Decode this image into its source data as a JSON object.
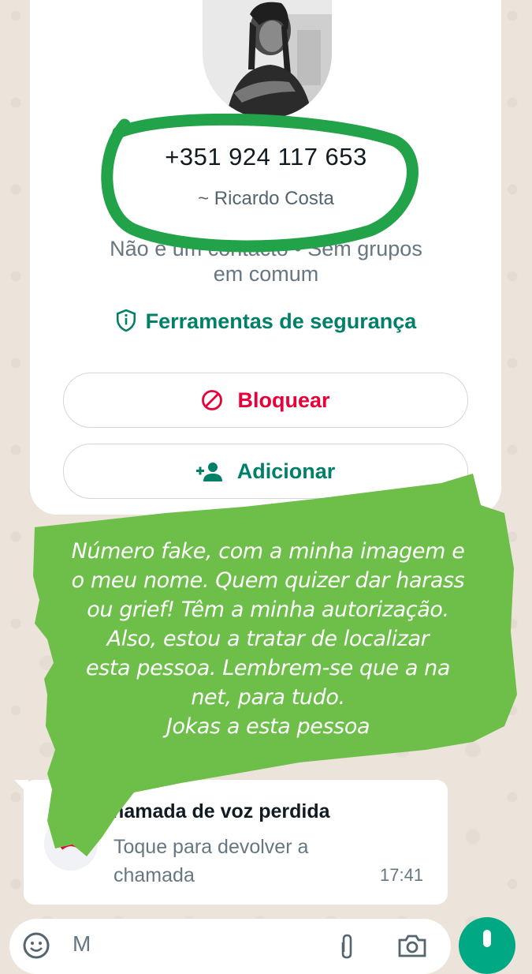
{
  "contact": {
    "phone_number": "+351 924 117 653",
    "push_name": "~ Ricardo Costa",
    "info_line_1": "Não é um contacto • Sem grupos",
    "info_line_2": "em comum",
    "safety_tools_label": "Ferramentas de segurança"
  },
  "actions": {
    "block_label": "Bloquear",
    "add_label": "Adicionar"
  },
  "call_message": {
    "title": "Chamada de voz perdida",
    "subtitle": "Toque para devolver a chamada",
    "time": "17:41"
  },
  "composer": {
    "placeholder": "M"
  },
  "overlay_note": {
    "lines": [
      "Número fake, com a minha imagem e",
      "o meu nome. Quem quizer dar harass",
      "ou grief! Têm a minha autorização.",
      "Also, estou a tratar de localizar",
      "esta pessoa. Lembrem-se que a na",
      "net, para tudo.",
      "Jokas a esta pessoa"
    ]
  },
  "colors": {
    "accent_green": "#008069",
    "block_red": "#ea0038",
    "marker_green": "#6dbf4a",
    "circle_green": "#22a34a"
  },
  "icons": [
    "shield-info-icon",
    "block-icon",
    "add-person-icon",
    "missed-call-icon",
    "emoji-icon",
    "attach-icon",
    "camera-icon",
    "mic-icon"
  ]
}
